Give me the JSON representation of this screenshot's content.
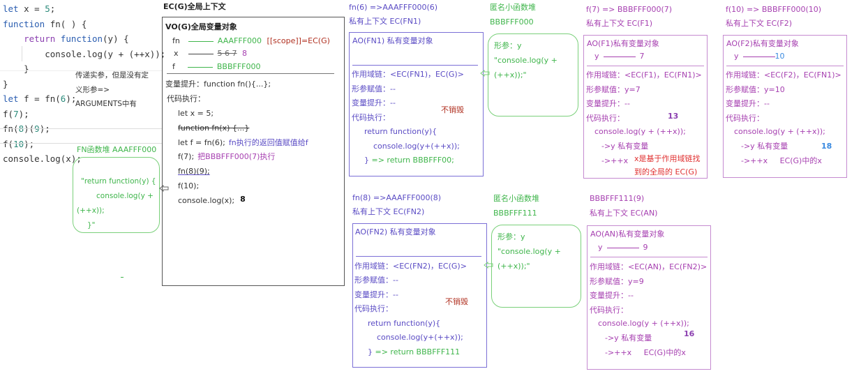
{
  "code_panel": {
    "lines": [
      {
        "parts": [
          {
            "t": "let",
            "c": "kw2"
          },
          {
            "t": " x = ",
            "c": "plain"
          },
          {
            "t": "5",
            "c": "num"
          },
          {
            "t": ";",
            "c": "plain"
          }
        ]
      },
      {
        "parts": [
          {
            "t": "function",
            "c": "kw2"
          },
          {
            "t": " fn( ) {",
            "c": "plain"
          }
        ]
      },
      {
        "parts": [
          {
            "t": "    return ",
            "c": "kw"
          },
          {
            "t": "function",
            "c": "kw2"
          },
          {
            "t": "(y) {",
            "c": "plain"
          }
        ]
      },
      {
        "parts": [
          {
            "t": "        console.log(y + (++x));",
            "c": "plain"
          }
        ]
      },
      {
        "parts": [
          {
            "t": "    }",
            "c": "plain"
          }
        ]
      },
      {
        "parts": [
          {
            "t": "}",
            "c": "plain"
          }
        ]
      },
      {
        "parts": [
          {
            "t": "let",
            "c": "kw2"
          },
          {
            "t": " f = fn(",
            "c": "plain"
          },
          {
            "t": "6",
            "c": "num"
          },
          {
            "t": ");",
            "c": "plain"
          }
        ]
      },
      {
        "parts": [
          {
            "t": "f(",
            "c": "plain"
          },
          {
            "t": "7",
            "c": "num"
          },
          {
            "t": ");",
            "c": "plain"
          }
        ]
      },
      {
        "parts": [
          {
            "t": "fn(",
            "c": "plain"
          },
          {
            "t": "8",
            "c": "num"
          },
          {
            "t": ")(",
            "c": "plain"
          },
          {
            "t": "9",
            "c": "num"
          },
          {
            "t": ");",
            "c": "plain"
          }
        ]
      },
      {
        "parts": [
          {
            "t": "f(",
            "c": "plain"
          },
          {
            "t": "10",
            "c": "num"
          },
          {
            "t": ");",
            "c": "plain"
          }
        ]
      },
      {
        "parts": [
          {
            "t": "console.log(x);",
            "c": "plain"
          }
        ]
      }
    ],
    "note_lines": [
      "传递实参，但是没有定",
      "义形参=>",
      "ARGUMENTS中有"
    ]
  },
  "fn_heap": {
    "title": "FN函数堆 AAAFFF000",
    "lines": [
      "\"return function(y) {",
      "console.log(y +",
      "(++x));",
      "}\""
    ]
  },
  "ec_g": {
    "title": "EC(G)全局上下文",
    "vo_title": "VO(G)全局变量对象",
    "vars": [
      {
        "name": "fn",
        "value": "AAAFFF000",
        "extra": "[[scope]]=EC(G)"
      },
      {
        "name": "x",
        "value": "5 6 7",
        "final": "8"
      },
      {
        "name": "f",
        "value": "BBBFFF000"
      }
    ],
    "hoist": "变量提升：function  fn(){...};",
    "exec_label": "代码执行：",
    "exec": [
      {
        "code": "let x = 5;"
      },
      {
        "code": "function fn(x) {...}",
        "strike": true
      },
      {
        "code": "let f = fn(6);",
        "note": "fn执行的返回值赋值给f",
        "note_color": "purple"
      },
      {
        "code": "f(7);",
        "note": "把BBBFFF000(7)执行",
        "note_color": "magenta"
      },
      {
        "code": "fn(8)(9);",
        "underline": true
      },
      {
        "code": "f(10);"
      },
      {
        "code": "console.log(x);",
        "result": "8"
      }
    ]
  },
  "fn1": {
    "call": "fn(6) =>AAAFFF000(6)",
    "ctx": "私有上下文 EC(FN1)",
    "ao": "AO(FN1) 私有变量对象",
    "scope": "作用域链：<EC(FN1)，EC(G)>",
    "param": "形参赋值：--",
    "hoist": "变量提升：--",
    "exec_label": "代码执行：",
    "exec": [
      "return function(y){",
      "console.log(y+(++x));",
      "}"
    ],
    "ret": "=> return BBBFFF00;",
    "not_destroyed": "不销毁"
  },
  "heap_bbb000": {
    "title": "匿名小函数堆",
    "addr": "BBBFFF000",
    "lines": [
      "形参：y",
      "\"console.log(y +",
      "(++x));\""
    ]
  },
  "f1": {
    "call": "f(7) => BBBFFF000(7)",
    "ctx": "私有上下文 EC(F1)",
    "ao": "AO(F1)私有变量对象",
    "var_name": "y",
    "var_value": "7",
    "scope": "作用域链：<EC(F1)，EC(FN1)>",
    "param": "形参赋值：y=7",
    "hoist": "变量提升：--",
    "exec_label": "代码执行：",
    "result": "13",
    "exec": "console.log(y + (++x));",
    "y_note": "->y   私有变量",
    "x_note": "->++x",
    "x_explain": [
      "x是基于作用域链找",
      "到的全局的 EC(G)"
    ]
  },
  "f2": {
    "call": "f(10) => BBBFFF000(10)",
    "ctx": "私有上下文 EC(F2)",
    "ao": "AO(F2)私有变量对象",
    "var_name": "y",
    "var_value": "10",
    "scope": "作用域链：<EC(F2)，EC(FN1)>",
    "param": "形参赋值：y=10",
    "hoist": "变量提升：--",
    "exec_label": "代码执行：",
    "exec": "console.log(y + (++x));",
    "y_note": "->y   私有变量",
    "result": "18",
    "x_note": "->++x     EC(G)中的x"
  },
  "fn2": {
    "call": "fn(8) =>AAAFFF000(8)",
    "ctx": "私有上下文 EC(FN2)",
    "ao": "AO(FN2) 私有变量对象",
    "scope": "作用域链：<EC(FN2)，EC(G)>",
    "param": "形参赋值：--",
    "hoist": "变量提升：--",
    "exec_label": "代码执行：",
    "exec": [
      "return function(y){",
      "console.log(y+(++x));",
      "}"
    ],
    "ret": "=> return BBBFFF111",
    "not_destroyed": "不销毁"
  },
  "heap_bbb111": {
    "title": "匿名小函数堆",
    "addr": "BBBFFF111",
    "lines": [
      "形参：y",
      "\"console.log(y +",
      "(++x));\""
    ]
  },
  "an": {
    "call": "BBBFFF111(9)",
    "ctx": "私有上下文 EC(AN)",
    "ao": "AO(AN)私有变量对象",
    "var_name": "y",
    "var_value": "9",
    "scope": "作用域链：<EC(AN)，EC(FN2)>",
    "param": "形参赋值：y=9",
    "hoist": "变量提升：--",
    "exec_label": "代码执行：",
    "exec": "console.log(y + (++x));",
    "result": "16",
    "y_note": "->y   私有变量",
    "x_note": "->++x     EC(G)中的x"
  }
}
